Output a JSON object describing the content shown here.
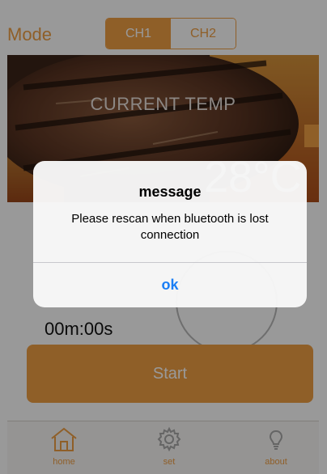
{
  "header": {
    "mode_label": "Mode",
    "channels": [
      "CH1",
      "CH2"
    ],
    "active_channel": "CH1"
  },
  "display": {
    "current_temp_label": "CURRENT TEMP",
    "temp_value": "28°C"
  },
  "timer": {
    "value": "00m:00s"
  },
  "start_button": {
    "label": "Start"
  },
  "tabbar": {
    "items": [
      {
        "label": "home",
        "icon": "home-icon"
      },
      {
        "label": "set",
        "icon": "gear-icon"
      },
      {
        "label": "about",
        "icon": "lightbulb-icon"
      }
    ]
  },
  "dialog": {
    "title": "message",
    "message": "Please rescan when bluetooth is lost connection",
    "ok_label": "ok"
  },
  "colors": {
    "accent": "#ef9e44",
    "link_blue": "#1a7ef5"
  }
}
